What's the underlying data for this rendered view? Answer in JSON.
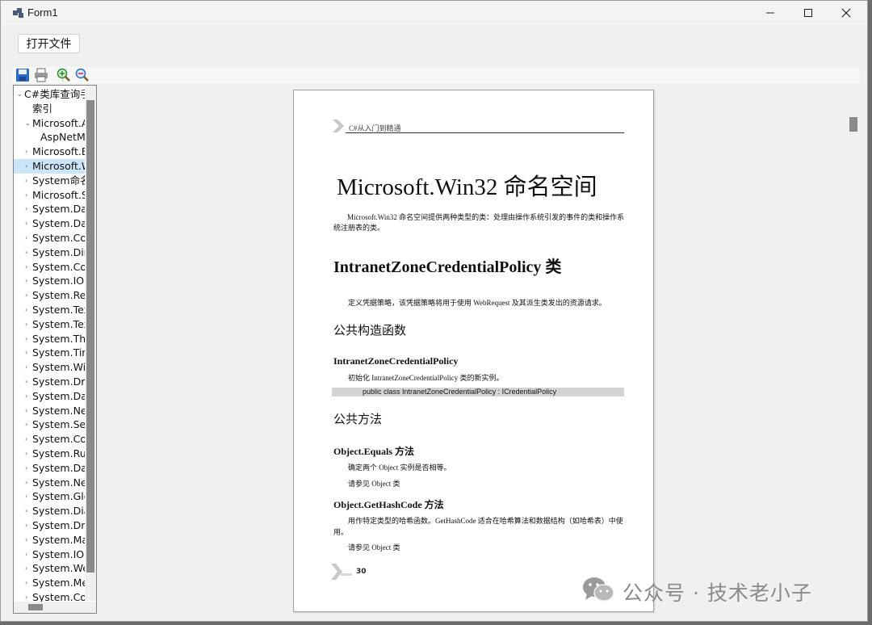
{
  "window": {
    "title": "Form1"
  },
  "buttons": {
    "open_file": "打开文件"
  },
  "toolbar": {
    "icons": [
      "save-icon",
      "print-icon",
      "zoom-in-icon",
      "zoom-out-icon"
    ]
  },
  "tree": {
    "items": [
      {
        "label": "C#类库查询手",
        "arrow": "⌄",
        "level": 0,
        "selected": false
      },
      {
        "label": "索引",
        "arrow": "",
        "level": 1,
        "selected": false
      },
      {
        "label": "Microsoft.A",
        "arrow": "⌄",
        "level": 1,
        "selected": false
      },
      {
        "label": "AspNetM",
        "arrow": "",
        "level": 2,
        "selected": false
      },
      {
        "label": "Microsoft.B",
        "arrow": "›",
        "level": 1,
        "selected": false
      },
      {
        "label": "Microsoft.W",
        "arrow": "›",
        "level": 1,
        "selected": true
      },
      {
        "label": "System命名",
        "arrow": "›",
        "level": 1,
        "selected": false
      },
      {
        "label": "Microsoft.S",
        "arrow": "›",
        "level": 1,
        "selected": false
      },
      {
        "label": "System.Dat",
        "arrow": "›",
        "level": 1,
        "selected": false
      },
      {
        "label": "System.Dat",
        "arrow": "›",
        "level": 1,
        "selected": false
      },
      {
        "label": "System.Coll",
        "arrow": "›",
        "level": 1,
        "selected": false
      },
      {
        "label": "System.Dire",
        "arrow": "›",
        "level": 1,
        "selected": false
      },
      {
        "label": "System.Cor",
        "arrow": "›",
        "level": 1,
        "selected": false
      },
      {
        "label": "System.IO 命",
        "arrow": "›",
        "level": 1,
        "selected": false
      },
      {
        "label": "System.Refl",
        "arrow": "›",
        "level": 1,
        "selected": false
      },
      {
        "label": "System.Text",
        "arrow": "›",
        "level": 1,
        "selected": false
      },
      {
        "label": "System.Text",
        "arrow": "›",
        "level": 1,
        "selected": false
      },
      {
        "label": "System.Thr",
        "arrow": "›",
        "level": 1,
        "selected": false
      },
      {
        "label": "System.Tim",
        "arrow": "›",
        "level": 1,
        "selected": false
      },
      {
        "label": "System.Win",
        "arrow": "›",
        "level": 1,
        "selected": false
      },
      {
        "label": "System.Dra",
        "arrow": "›",
        "level": 1,
        "selected": false
      },
      {
        "label": "System.Dat",
        "arrow": "›",
        "level": 1,
        "selected": false
      },
      {
        "label": "System.Net",
        "arrow": "›",
        "level": 1,
        "selected": false
      },
      {
        "label": "System.Sec",
        "arrow": "›",
        "level": 1,
        "selected": false
      },
      {
        "label": "System.Coll",
        "arrow": "›",
        "level": 1,
        "selected": false
      },
      {
        "label": "System.Run",
        "arrow": "›",
        "level": 1,
        "selected": false
      },
      {
        "label": "System.Dat",
        "arrow": "›",
        "level": 1,
        "selected": false
      },
      {
        "label": "System.Net",
        "arrow": "›",
        "level": 1,
        "selected": false
      },
      {
        "label": "System.Glo",
        "arrow": "›",
        "level": 1,
        "selected": false
      },
      {
        "label": "System.Diag",
        "arrow": "›",
        "level": 1,
        "selected": false
      },
      {
        "label": "System.Dra",
        "arrow": "›",
        "level": 1,
        "selected": false
      },
      {
        "label": "System.Mar",
        "arrow": "›",
        "level": 1,
        "selected": false
      },
      {
        "label": "System.IO.P",
        "arrow": "›",
        "level": 1,
        "selected": false
      },
      {
        "label": "System.Wel",
        "arrow": "›",
        "level": 1,
        "selected": false
      },
      {
        "label": "System.Mes",
        "arrow": "›",
        "level": 1,
        "selected": false
      },
      {
        "label": "System.Cor",
        "arrow": "›",
        "level": 1,
        "selected": false
      }
    ]
  },
  "document": {
    "header": "C#从入门到精通",
    "title": "Microsoft.Win32  命名空间",
    "intro_line1": "Microsoft.Win32  命名空间提供两种类型的类：处理由操作系统引发的事件的类和操作系",
    "intro_line2": "统注册表的类。",
    "class_heading": "IntranetZoneCredentialPolicy  类",
    "class_desc": "定义凭据策略，该凭据策略将用于使用  WebRequest  及其派生类发出的资源请求。",
    "ctor_section": "公共构造函数",
    "ctor_name": "IntranetZoneCredentialPolicy",
    "ctor_desc": "初始化  IntranetZoneCredentialPolicy  类的新实例。",
    "code": "public class IntranetZoneCredentialPolicy : ICredentialPolicy",
    "methods_section": "公共方法",
    "method1_name": "Object.Equals  方法",
    "method1_desc": "确定两个  Object  实例是否相等。",
    "method1_see": "请参见 Object  类",
    "method2_name": "Object.GetHashCode  方法",
    "method2_desc1": "用作特定类型的哈希函数。GetHashCode  适合在哈希算法和数据结构（如哈希表）中使",
    "method2_desc2": "用。",
    "method2_see": "请参见 Object  类",
    "page_number": "30"
  },
  "watermark": {
    "text": "公众号 · 技术老小子"
  }
}
